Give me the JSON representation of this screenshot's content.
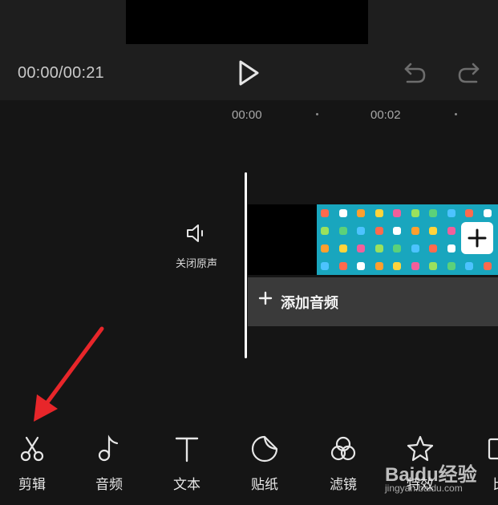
{
  "player": {
    "time_display": "00:00/00:21",
    "play_icon": "play-icon",
    "undo_icon": "undo-icon",
    "redo_icon": "redo-icon"
  },
  "timeline": {
    "ruler_labels": [
      "00:00",
      "00:02"
    ],
    "mute_label": "关闭原声",
    "mute_icon": "speaker-icon",
    "add_clip_icon": "plus-icon",
    "add_audio_label": "添加音频"
  },
  "toolbar": {
    "items": [
      {
        "label": "剪辑",
        "icon": "scissors-icon"
      },
      {
        "label": "音频",
        "icon": "music-note-icon"
      },
      {
        "label": "文本",
        "icon": "text-icon"
      },
      {
        "label": "贴纸",
        "icon": "sticker-icon"
      },
      {
        "label": "滤镜",
        "icon": "filter-icon"
      },
      {
        "label": "特效",
        "icon": "effects-star-icon"
      },
      {
        "label": "比",
        "icon": "ratio-icon"
      }
    ]
  },
  "annotation": {
    "arrow_color": "#e8262a"
  },
  "watermark": {
    "logo": "Baidu经验",
    "url": "jingyan.baidu.com"
  },
  "colors": {
    "background": "#151515",
    "panel": "#1e1e1e",
    "clip_thumbnail": "#19a6be",
    "add_audio_bg": "#3a3a3a"
  }
}
